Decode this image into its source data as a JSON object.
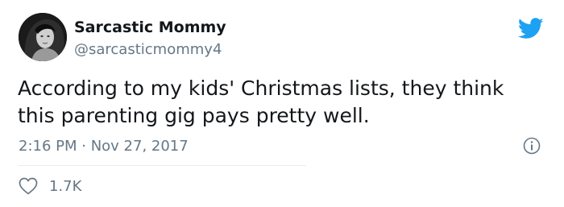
{
  "author": {
    "display_name": "Sarcastic Mommy",
    "handle": "@sarcasticmommy4"
  },
  "tweet": {
    "text": "According to my kids' Christmas lists, they think this parenting gig pays pretty well.",
    "timestamp": "2:16 PM · Nov 27, 2017"
  },
  "engagement": {
    "likes": "1.7K"
  },
  "icons": {
    "brand": "twitter-bird-icon",
    "info": "info-icon",
    "like": "heart-icon"
  },
  "colors": {
    "brand_blue": "#1da1f2",
    "secondary_text": "#657786",
    "primary_text": "#14171a",
    "divider": "#e6ecf0"
  }
}
